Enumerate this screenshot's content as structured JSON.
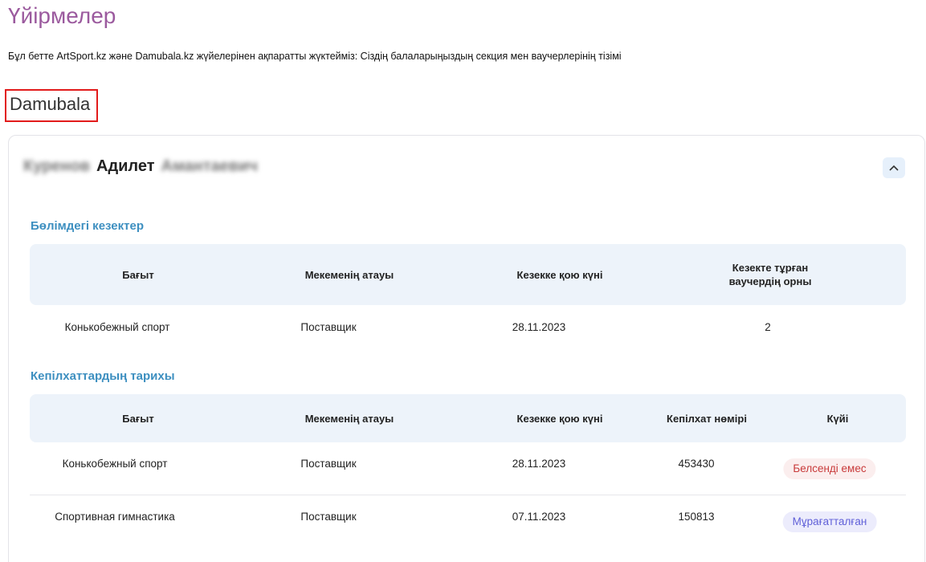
{
  "page": {
    "title": "Үйірмелер",
    "intro": "Бұл бетте ArtSport.kz және Damubala.kz жүйелерінен ақпаратты жүктейміз: Сіздің балаларыңыздың секция мен ваучерлерінің тізімі",
    "section_label": "Damubala"
  },
  "child": {
    "last_name": "Куренов",
    "first_name": "Адилет",
    "patronymic": "Амантаевич",
    "collapse_icon": "chevron-up-icon"
  },
  "queue": {
    "heading": "Бөлімдегі кезектер",
    "columns": [
      "Бағыт",
      "Мекеменің атауы",
      "Кезекке қою күні",
      "Кезекте тұрған ваучердің орны"
    ],
    "rows": [
      [
        "Конькобежный спорт",
        "Поставщик",
        "28.11.2023",
        "2"
      ]
    ]
  },
  "vouchers": {
    "heading": "Кепілхаттардың тарихы",
    "columns": [
      "Бағыт",
      "Мекеменің атауы",
      "Кезекке қою күні",
      "Кепілхат нөмірі",
      "Күйі"
    ],
    "rows": [
      {
        "direction": "Конькобежный спорт",
        "org": "Поставщик",
        "date": "28.11.2023",
        "number": "453430",
        "status": "Белсенді емес",
        "status_color": "#c83a3a"
      },
      {
        "direction": "Спортивная гимнастика",
        "org": "Поставщик",
        "date": "07.11.2023",
        "number": "150813",
        "status": "Мұрағатталған",
        "status_color": "#6060d8"
      }
    ]
  },
  "colors": {
    "title": "#9b5a9e",
    "heading": "#3d8fc0",
    "table_header_bg": "#edf3fa",
    "highlight_border": "#e21b1b"
  }
}
